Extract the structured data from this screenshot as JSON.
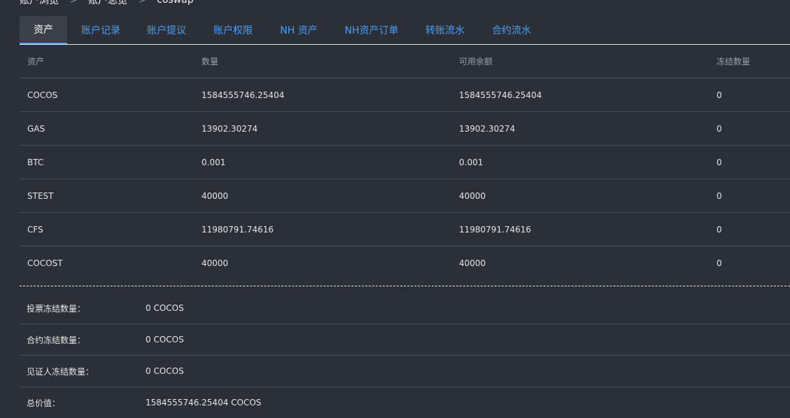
{
  "breadcrumb": {
    "items": [
      "账户浏览",
      "账户总览",
      "coswap"
    ]
  },
  "tabs": [
    {
      "label": "资产",
      "active": true
    },
    {
      "label": "账户记录"
    },
    {
      "label": "账户提议"
    },
    {
      "label": "账户权限"
    },
    {
      "label": "NH 资产"
    },
    {
      "label": "NH资产订单"
    },
    {
      "label": "转账流水"
    },
    {
      "label": "合约流水"
    }
  ],
  "table": {
    "headers": [
      "资产",
      "数量",
      "可用余额",
      "冻结数量"
    ],
    "rows": [
      [
        "COCOS",
        "1584555746.25404",
        "1584555746.25404",
        "0"
      ],
      [
        "GAS",
        "13902.30274",
        "13902.30274",
        "0"
      ],
      [
        "BTC",
        "0.001",
        "0.001",
        "0"
      ],
      [
        "STEST",
        "40000",
        "40000",
        "0"
      ],
      [
        "CFS",
        "11980791.74616",
        "11980791.74616",
        "0"
      ],
      [
        "COCOST",
        "40000",
        "40000",
        "0"
      ]
    ]
  },
  "summary": [
    {
      "label": "投票冻结数量：",
      "value": "0 COCOS"
    },
    {
      "label": "合约冻结数量：",
      "value": "0 COCOS"
    },
    {
      "label": "见证人冻结数量：",
      "value": "0 COCOS"
    },
    {
      "label": "总价值：",
      "value": "1584555746.25404 COCOS"
    }
  ],
  "colors": {
    "background": "#2b2f37",
    "accent": "#4a9ef5"
  }
}
